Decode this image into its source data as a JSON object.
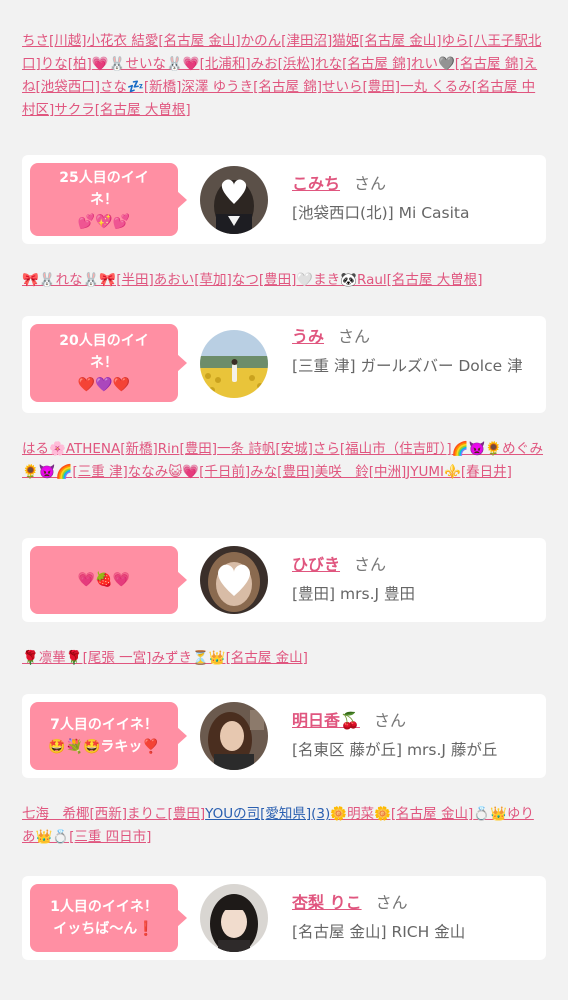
{
  "likers_1": [
    {
      "text": "ちさ[川越]"
    },
    {
      "text": "小花衣 結愛[名古屋 金山]"
    },
    {
      "text": "かのん[津田沼]"
    },
    {
      "text": "猫姫[名古屋 金山]"
    },
    {
      "text": "ゆら[八王子駅北口]"
    },
    {
      "text": "りな[柏]"
    },
    {
      "text": "💗🐰せいな🐰💗[北浦和]"
    },
    {
      "text": "みお[浜松]"
    },
    {
      "text": "れな[名古屋 錦]"
    },
    {
      "text": "れい🩶[名古屋 錦]"
    },
    {
      "text": "えね[池袋西口]"
    },
    {
      "text": "さな💤[新橋]"
    },
    {
      "text": "深澤 ゆうき[名古屋 錦]"
    },
    {
      "text": "せいら[豊田]"
    },
    {
      "text": "一丸 くるみ[名古屋 中村区]"
    },
    {
      "text": "サクラ[名古屋 大曽根]"
    }
  ],
  "cards": [
    {
      "bubble_line1": "25人目のイイ",
      "bubble_line2": "ネ！",
      "bubble_line3": "💕💖💕",
      "name": "こみち",
      "honorific": "さん",
      "shop": "[池袋西口(北)] Mi Casita",
      "avatar": "avatar-heart-sticker"
    },
    {
      "bubble_line1": "20人目のイイ",
      "bubble_line2": "ネ！",
      "bubble_line3": "❤️💜❤️",
      "name": "うみ",
      "honorific": "さん",
      "shop": "[三重 津] ガールズバー Dolce 津",
      "avatar": "avatar-sunflower-field"
    },
    {
      "bubble_line1": "💗🍓💗",
      "name": "ひびき",
      "honorific": "さん",
      "shop": "[豊田] mrs.J 豊田",
      "avatar": "avatar-heart-sticker"
    },
    {
      "bubble_line1": "7人目のイイネ！",
      "bubble_line2": "🤩💐🤩ラキッ❣️",
      "name": "明日香🍒",
      "honorific": "さん",
      "shop": "[名東区 藤が丘] mrs.J 藤が丘",
      "avatar": "avatar-woman"
    },
    {
      "bubble_line1": "1人目のイイネ！",
      "bubble_line2": "イッちば〜ん❗",
      "name": "杏梨 りこ",
      "honorific": "さん",
      "shop": "[名古屋 金山] RICH 金山",
      "avatar": "avatar-woman"
    }
  ],
  "likers_2": [
    {
      "text": "🎀🐰れな🐰🎀[半田]"
    },
    {
      "text": "あおい[草加]"
    },
    {
      "text": "なつ[豊田]"
    },
    {
      "text": "🤍まき🐼"
    },
    {
      "text": "Raul[名古屋 大曽根]"
    }
  ],
  "likers_3": [
    {
      "text": "はる🌸ATHENA[新橋]"
    },
    {
      "text": "Rin[豊田]"
    },
    {
      "text": "一条 詩帆[安城]"
    },
    {
      "text": "さら[福山市（住吉町）]"
    },
    {
      "text": "🌈👿🌻めぐみ🌻👿🌈[三重 津]"
    },
    {
      "text": "ななみ😺💗[千日前]"
    },
    {
      "text": "みな[豊田]"
    },
    {
      "text": "美咲　鈴[中洲]"
    },
    {
      "text": "JYUMI⚜️[春日井]"
    }
  ],
  "likers_4": [
    {
      "text": "🌹凛華🌹[尾張 一宮]"
    },
    {
      "text": "みずき⏳👑[名古屋 金山]"
    }
  ],
  "likers_5": [
    {
      "text": "七海　希椰[西新]",
      "blue": false
    },
    {
      "text": "まりこ[豊田]",
      "blue": false
    },
    {
      "text": "YOUの司[愛知県](3)",
      "blue": true
    },
    {
      "text": "🌼明菜🌼[名古屋 金山]",
      "blue": false
    },
    {
      "text": "💍👑ゆりあ👑💍[三重 四日市]",
      "blue": false
    }
  ],
  "colors": {
    "accent": "#e0567f",
    "bubble": "#ff8fa3",
    "link_blue": "#2a5fb0",
    "bg": "#f2f2f2"
  }
}
